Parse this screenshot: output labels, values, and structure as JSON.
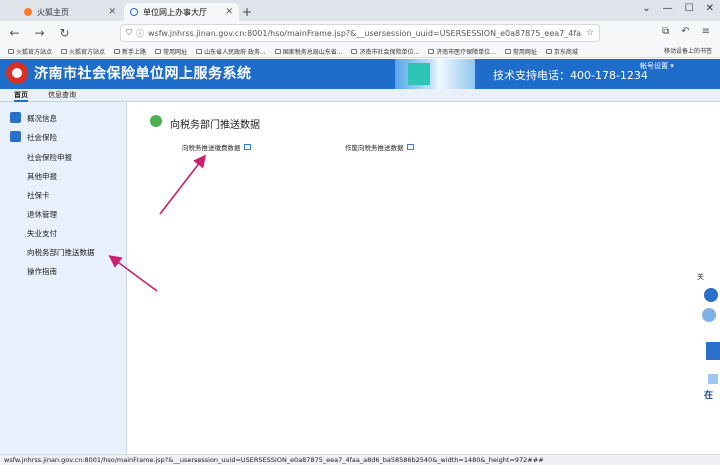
{
  "browser": {
    "tabs": [
      {
        "title": "火狐主页",
        "active": false
      },
      {
        "title": "单位网上办事大厅",
        "active": true
      }
    ],
    "new_tab": "+",
    "window_controls": [
      "⌄",
      "—",
      "☐",
      "✕"
    ],
    "url": "wsfw.jnhrss.jinan.gov.cn:8001/hso/mainFrame.jsp?&__usersession_uuid=USERSESSION_e0a87875_eea7_4faa_a8d6_ba58586b2540&_width=",
    "bookmarks": [
      "火狐官方站点",
      "火狐官方站点",
      "新手上路",
      "常用网址",
      "山东省人民政府 政务...",
      "国家税务总局山东省...",
      "济南市社会保险单位...",
      "济南市医疗保障单位...",
      "常用网址",
      "京东商城"
    ],
    "bookmarks_right": "移动设备上的书签"
  },
  "app": {
    "title": "济南市社会保险单位网上服务系统",
    "support": "技术支持电话：400-178-1234",
    "account": "帐号设置 ▾"
  },
  "menu": {
    "home": "首页",
    "info": "信息查询"
  },
  "sidebar": {
    "items": [
      {
        "label": "概况信息",
        "icon": "home-icon"
      },
      {
        "label": "社会保险",
        "icon": "edit-icon"
      },
      {
        "label": "社会保险申报"
      },
      {
        "label": "其他申报"
      },
      {
        "label": "社保卡"
      },
      {
        "label": "退休管理"
      },
      {
        "label": "失业支付"
      },
      {
        "label": "向税务部门推送数据"
      },
      {
        "label": "操作指南"
      }
    ]
  },
  "main": {
    "title": "向税务部门推送数据",
    "links": [
      "向税务推送缴费数据",
      "作废向税务推送数据"
    ]
  },
  "float": {
    "label_top": "关",
    "label_bottom": "在"
  },
  "status": "wsfw.jnhrss.jinan.gov.cn:8001/hso/mainFrame.jsp?&__usersession_uuid=USERSESSION_e0a87875_eea7_4faa_a8d6_ba58586b2540&_width=1480&_height=972###",
  "colors": {
    "header": "#1f6dcb",
    "sidebar": "#e8f0fc",
    "arrow": "#cc1f6e"
  }
}
